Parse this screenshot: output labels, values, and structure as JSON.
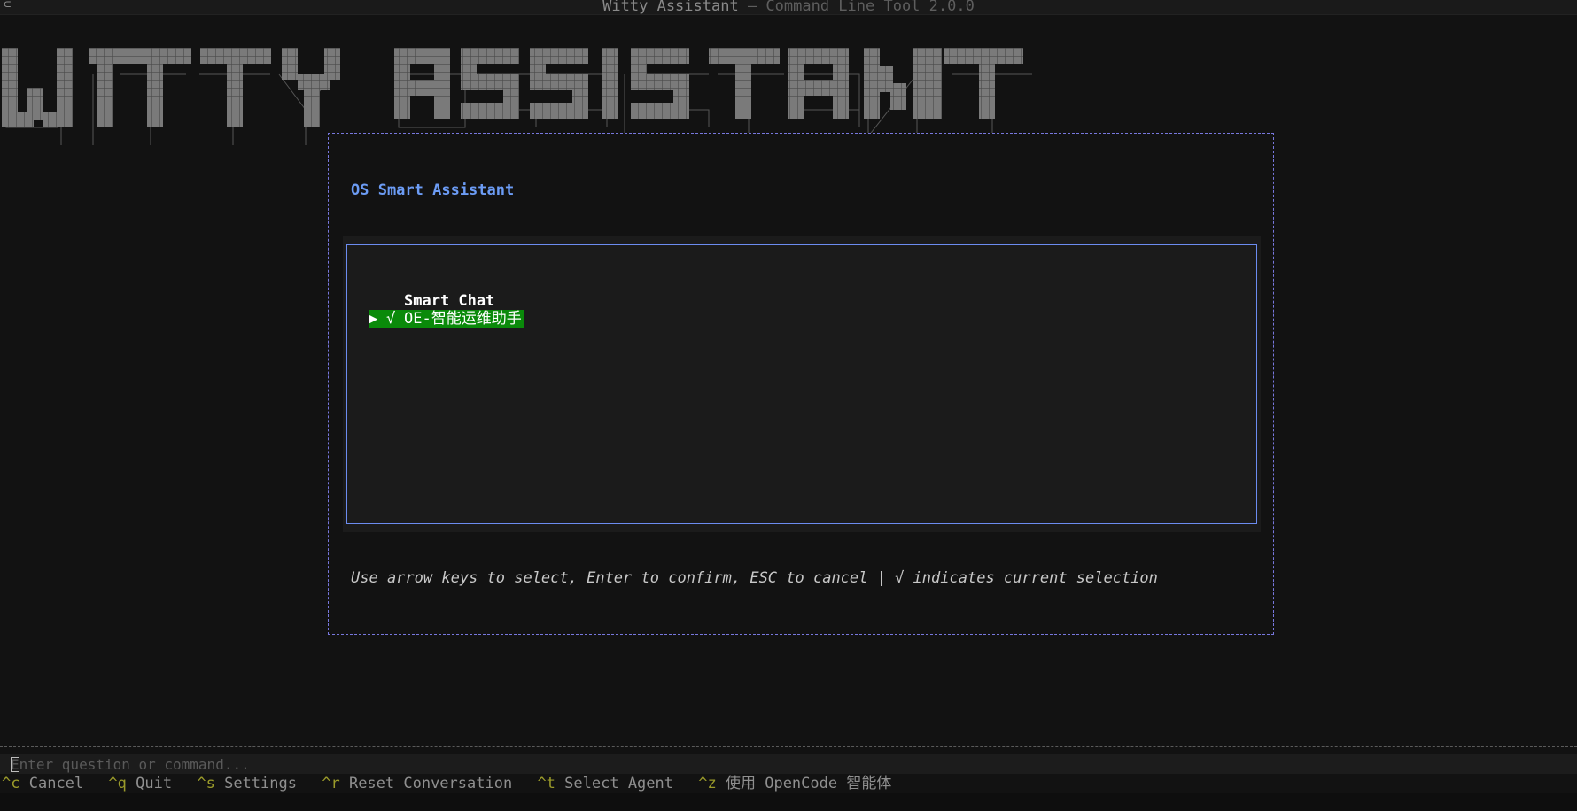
{
  "window": {
    "title_main": "Witty Assistant",
    "title_sep": " — ",
    "title_sub": "Command Line Tool 2.0.0"
  },
  "banner": {
    "text": "WITTY ASSISTANT"
  },
  "dialog": {
    "title": "OS Smart Assistant",
    "items": [
      {
        "label": "Smart Chat",
        "selected": false
      },
      {
        "label": "OE-智能运维助手",
        "selected": true,
        "pointer": "▶",
        "check": "√"
      }
    ],
    "hint": "Use arrow keys to select, Enter to confirm, ESC to cancel | √ indicates current selection"
  },
  "input": {
    "placeholder": "Enter question or command..."
  },
  "shortcuts": [
    {
      "key": "^c",
      "label": "Cancel"
    },
    {
      "key": "^q",
      "label": "Quit"
    },
    {
      "key": "^s",
      "label": "Settings"
    },
    {
      "key": "^r",
      "label": "Reset Conversation"
    },
    {
      "key": "^t",
      "label": "Select Agent"
    },
    {
      "key": "^z",
      "label": "使用 OpenCode 智能体"
    }
  ],
  "colors": {
    "accent": "#6c9cf5",
    "selection": "#0a8a0a",
    "shortcut_key": "#9a9a2a",
    "border": "#7777dd"
  }
}
